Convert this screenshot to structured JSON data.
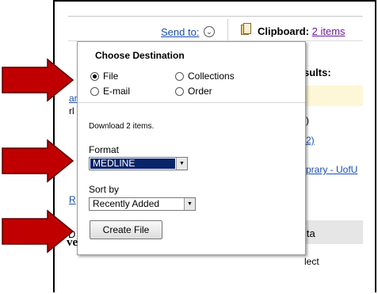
{
  "header": {
    "send_to_label": "Send to:",
    "chevron_icon": "chevron-down-circle-icon",
    "clipboard_icon": "clipboard-icon",
    "clipboard_label": "Clipboard:",
    "clipboard_link": "2 items"
  },
  "background_page": {
    "results_label": "sults:",
    "link_fragment_1": "ar",
    "text_fragment_rl": "rl",
    "text_fragment_paren": ")",
    "link_fragment_2": "2)",
    "link_fragment_3": "prary - UofU",
    "link_fragment_r": "R",
    "text_fragment_d": "D",
    "table_header": "ita",
    "select_fragment": "lect",
    "left_fragment": "ve"
  },
  "popup": {
    "title": "Choose Destination",
    "destinations": [
      {
        "label": "File",
        "selected": true
      },
      {
        "label": "Collections",
        "selected": false
      },
      {
        "label": "E-mail",
        "selected": false
      },
      {
        "label": "Order",
        "selected": false
      }
    ],
    "download_text": "Download 2 items.",
    "format_label": "Format",
    "format_value": "MEDLINE",
    "sort_label": "Sort by",
    "sort_value": "Recently Added",
    "create_button": "Create File"
  },
  "annotations": {
    "arrow_color": "#c00000",
    "arrow_count": 3
  }
}
